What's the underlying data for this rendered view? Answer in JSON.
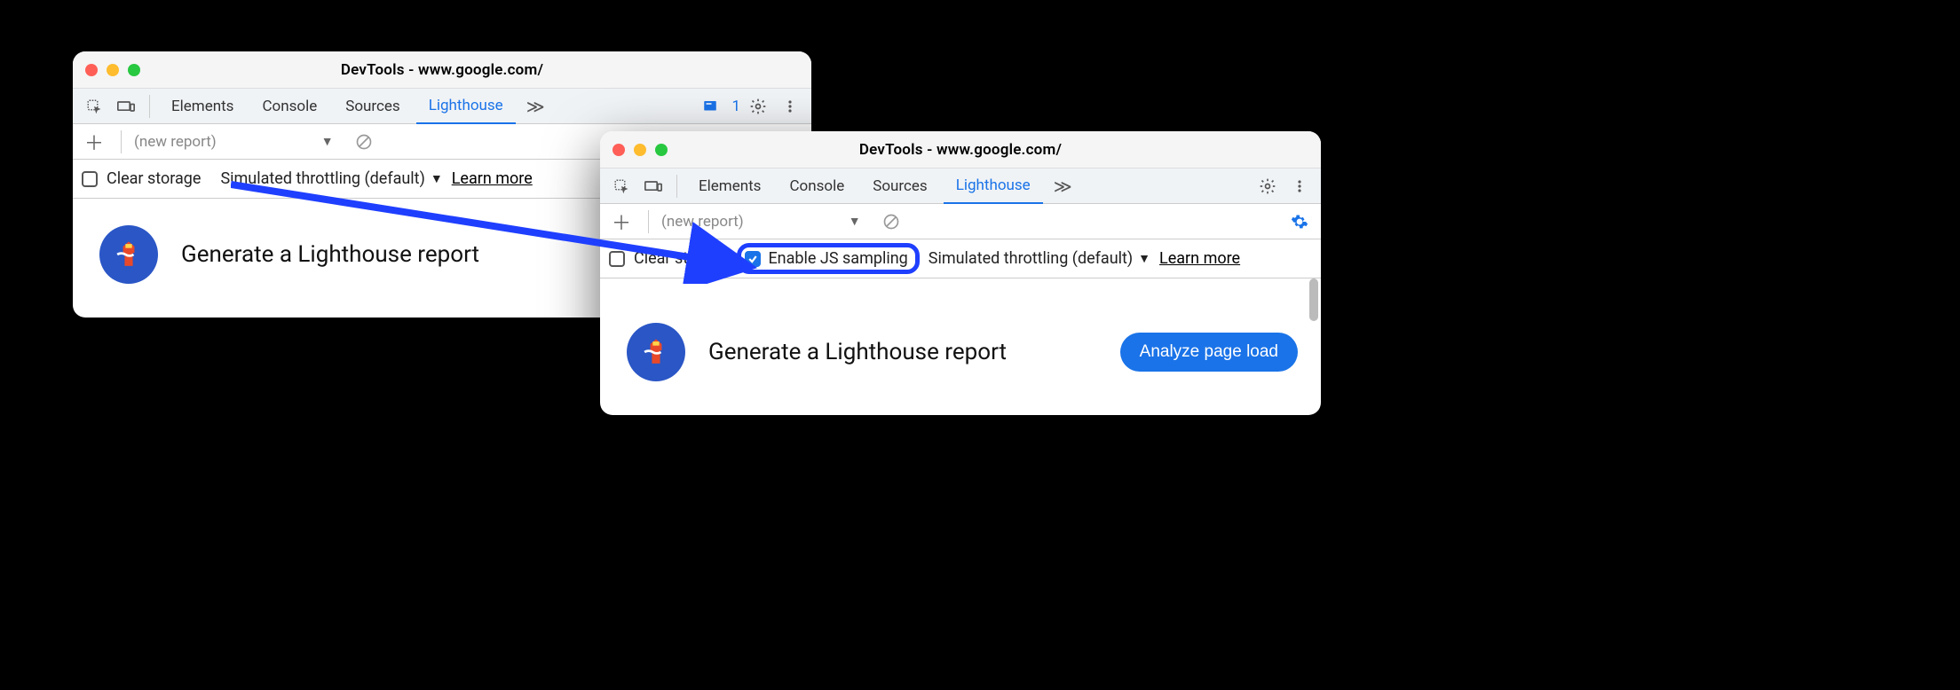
{
  "window_title": "DevTools - www.google.com/",
  "elements_icon": "elements",
  "tabs": {
    "elements": "Elements",
    "console": "Console",
    "sources": "Sources",
    "lighthouse": "Lighthouse"
  },
  "overflow_glyph": "≫",
  "issues_count": "1",
  "subbar": {
    "new_report": "(new report)"
  },
  "options": {
    "clear_storage": "Clear storage",
    "enable_js_sampling": "Enable JS sampling",
    "throttling": "Simulated throttling (default)",
    "learn_more": "Learn more"
  },
  "headline": "Generate a Lighthouse report",
  "analyze_label": "Analyze page load",
  "colors": {
    "accent": "#1a73e8",
    "highlight": "#1f3fff"
  }
}
